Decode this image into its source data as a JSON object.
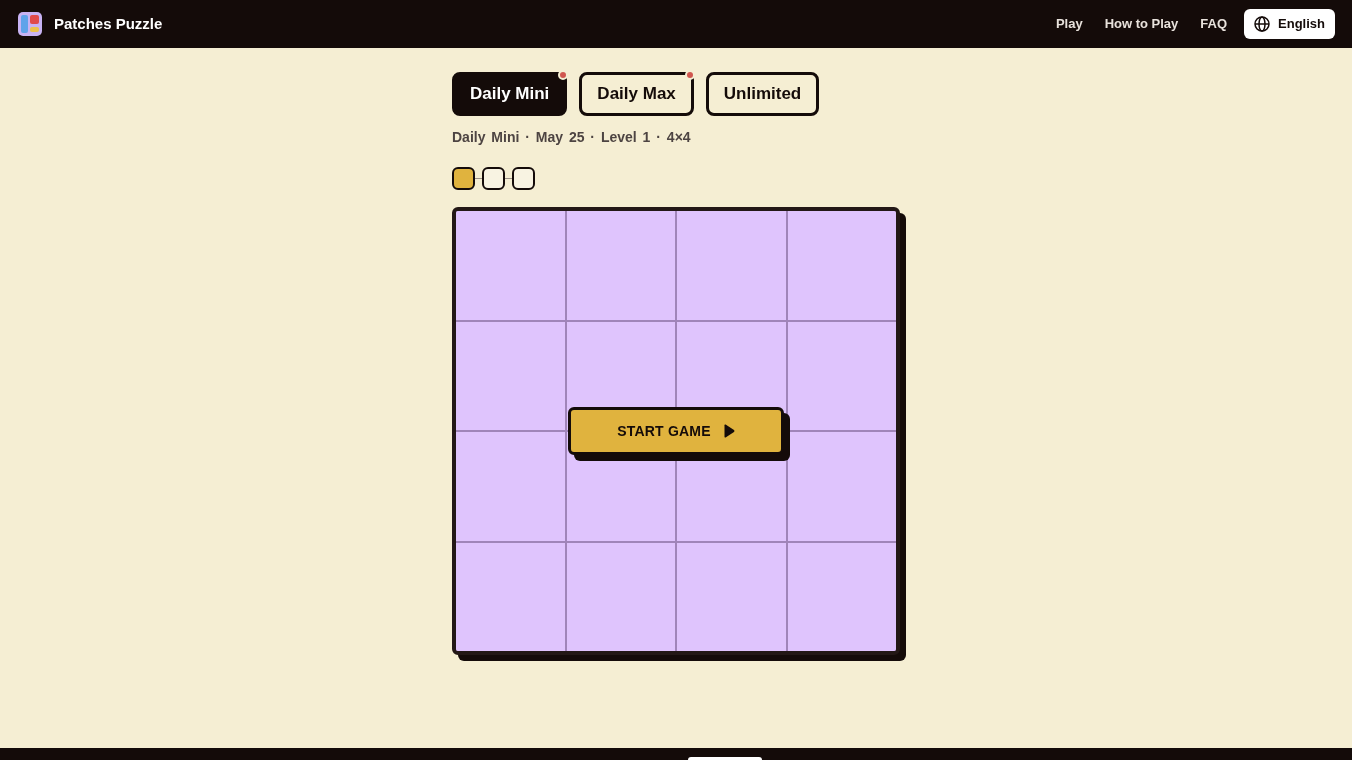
{
  "header": {
    "title": "Patches Puzzle",
    "nav_links": [
      "Play",
      "How to Play",
      "FAQ"
    ],
    "language_button": {
      "label": "English"
    }
  },
  "mode_tabs": [
    {
      "label": "Daily Mini",
      "selected": true,
      "dot": true
    },
    {
      "label": "Daily Max",
      "selected": false,
      "dot": true
    },
    {
      "label": "Unlimited",
      "selected": false,
      "dot": false
    }
  ],
  "puzzle_info": "Daily Mini · May 25 · Level 1 · 4×4",
  "level_steps": [
    {
      "current": true
    },
    {
      "current": false
    },
    {
      "current": false
    }
  ],
  "start_button": {
    "label": "START GAME"
  }
}
